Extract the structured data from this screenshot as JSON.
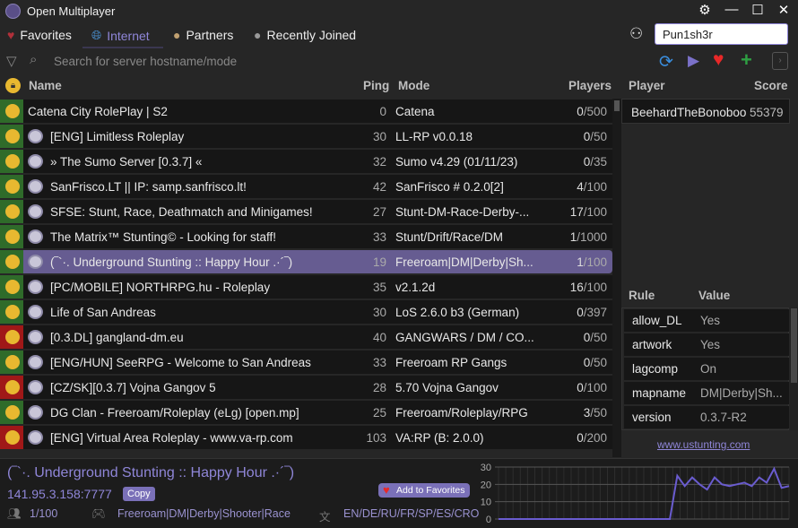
{
  "window": {
    "title": "Open Multiplayer"
  },
  "tabs": [
    {
      "label": "Favorites",
      "icon": "heart-icon"
    },
    {
      "label": "Internet",
      "icon": "globe-icon",
      "active": true
    },
    {
      "label": "Partners",
      "icon": "handshake-icon"
    },
    {
      "label": "Recently Joined",
      "icon": "clock-icon"
    }
  ],
  "nickname": "Pun1sh3r",
  "search": {
    "placeholder": "Search for server hostname/mode"
  },
  "columns": {
    "name": "Name",
    "ping": "Ping",
    "mode": "Mode",
    "players": "Players"
  },
  "servers": [
    {
      "name": "Catena City RolePlay | S2",
      "ping": "0",
      "mode": "Catena",
      "players": "0",
      "max": "/500",
      "locked": false,
      "omp": false
    },
    {
      "name": "[ENG] Limitless Roleplay",
      "ping": "30",
      "mode": "LL-RP v0.0.18",
      "players": "0",
      "max": "/50",
      "locked": false,
      "omp": true
    },
    {
      "name": "» The Sumo Server [0.3.7] «",
      "ping": "32",
      "mode": "Sumo v4.29 (01/11/23)",
      "players": "0",
      "max": "/35",
      "locked": false,
      "omp": true
    },
    {
      "name": "SanFrisco.LT || IP: samp.sanfrisco.lt!",
      "ping": "42",
      "mode": "SanFrisco # 0.2.0[2]",
      "players": "4",
      "max": "/100",
      "locked": false,
      "omp": true
    },
    {
      "name": "SFSE: Stunt, Race, Deathmatch and Minigames!",
      "ping": "27",
      "mode": "Stunt-DM-Race-Derby-...",
      "players": "17",
      "max": "/100",
      "locked": false,
      "omp": true
    },
    {
      "name": "The Matrix™ Stunting© - Looking for staff!",
      "ping": "33",
      "mode": "Stunt/Drift/Race/DM",
      "players": "1",
      "max": "/1000",
      "locked": false,
      "omp": true
    },
    {
      "name": "(‾`·. Underground Stunting :: Happy Hour .·´‾)",
      "ping": "19",
      "mode": "Freeroam|DM|Derby|Sh...",
      "players": "1",
      "max": "/100",
      "locked": false,
      "omp": true,
      "selected": true
    },
    {
      "name": "[PC/MOBILE] NORTHRPG.hu - Roleplay",
      "ping": "35",
      "mode": "v2.1.2d",
      "players": "16",
      "max": "/100",
      "locked": false,
      "omp": true
    },
    {
      "name": "Life of San Andreas",
      "ping": "30",
      "mode": "LoS 2.6.0 b3 (German)",
      "players": "0",
      "max": "/397",
      "locked": false,
      "omp": true
    },
    {
      "name": "[0.3.DL] gangland-dm.eu",
      "ping": "40",
      "mode": "GANGWARS / DM / CO...",
      "players": "0",
      "max": "/50",
      "locked": true,
      "omp": true
    },
    {
      "name": "[ENG/HUN] SeeRPG - Welcome to San Andreas",
      "ping": "33",
      "mode": "Freeroam RP Gangs",
      "players": "0",
      "max": "/50",
      "locked": false,
      "omp": true
    },
    {
      "name": "[CZ/SK][0.3.7] Vojna Gangov 5",
      "ping": "28",
      "mode": "5.70 Vojna Gangov",
      "players": "0",
      "max": "/100",
      "locked": true,
      "omp": true
    },
    {
      "name": "DG Clan - Freeroam/Roleplay (eLg) [open.mp]",
      "ping": "25",
      "mode": "Freeroam/Roleplay/RPG",
      "players": "3",
      "max": "/50",
      "locked": false,
      "omp": true
    },
    {
      "name": "[ENG] Virtual Area Roleplay - www.va-rp.com",
      "ping": "103",
      "mode": "VA:RP (B: 2.0.0)",
      "players": "0",
      "max": "/200",
      "locked": true,
      "omp": true
    }
  ],
  "player_panel": {
    "player_header": "Player",
    "score_header": "Score",
    "players": [
      {
        "name": "BeehardTheBonoboo",
        "score": "55379"
      }
    ]
  },
  "rules_panel": {
    "rule_header": "Rule",
    "value_header": "Value",
    "rules": [
      {
        "rule": "allow_DL",
        "value": "Yes"
      },
      {
        "rule": "artwork",
        "value": "Yes"
      },
      {
        "rule": "lagcomp",
        "value": "On"
      },
      {
        "rule": "mapname",
        "value": "DM|Derby|Sh..."
      },
      {
        "rule": "version",
        "value": "0.3.7-R2"
      }
    ],
    "website": "www.ustunting.com"
  },
  "details": {
    "name": "(‾`·. Underground Stunting :: Happy Hour .·´‾)",
    "address": "141.95.3.158:7777",
    "copy_label": "Copy",
    "add_favorite_label": "Add to Favorites",
    "players": "1/100",
    "mode": "Freeroam|DM|Derby|Shooter|Race",
    "language": "EN/DE/RU/FR/SP/ES/CRO"
  },
  "colors": {
    "accent": "#8f86d8",
    "selected_row": "#665c91",
    "unlocked": "#2f6b2a",
    "locked": "#a01818"
  },
  "chart_data": {
    "type": "line",
    "yticks": [
      0,
      10,
      20,
      30
    ],
    "ylim": [
      0,
      30
    ],
    "series": [
      {
        "values": [
          0,
          0,
          0,
          0,
          0,
          0,
          0,
          0,
          0,
          0,
          0,
          0,
          0,
          0,
          0,
          0,
          0,
          0,
          0,
          0,
          0,
          0,
          0,
          0,
          25,
          19,
          24,
          20,
          17,
          24,
          20,
          19,
          20,
          21,
          19,
          24,
          21,
          29,
          18,
          19
        ]
      }
    ],
    "grid": true
  }
}
